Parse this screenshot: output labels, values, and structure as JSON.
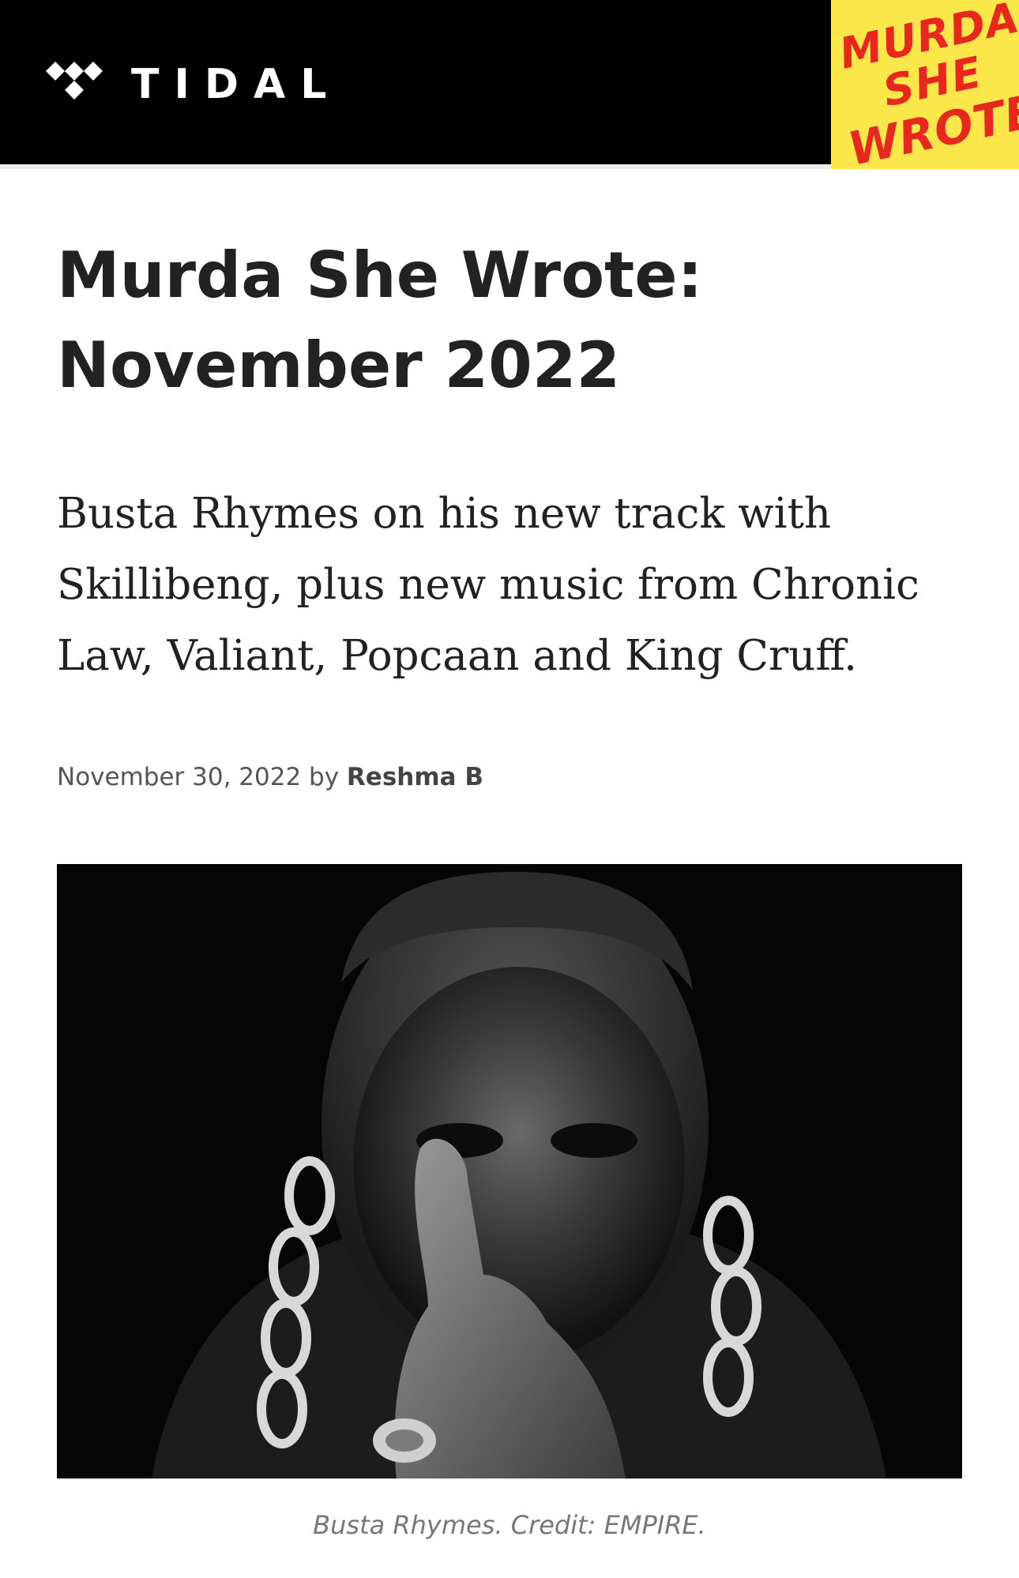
{
  "header": {
    "logo_text": "TIDAL",
    "logo_icon": "tidal-diamonds-icon",
    "badge_lines": [
      "MURDA",
      "SHE",
      "WROTE"
    ],
    "badge_colors": {
      "background": "#fbe74a",
      "text": "#e8271f"
    },
    "bar_color": "#000000"
  },
  "article": {
    "title": "Murda She Wrote: November 2022",
    "dek": "Busta Rhymes on his new track with Skillibeng, plus new music from Chronic Law, Valiant, Popcaan and King Cruff.",
    "date": "November 30, 2022",
    "by": "by",
    "author": "Reshma B",
    "hero_caption": "Busta Rhymes. Credit: EMPIRE."
  }
}
